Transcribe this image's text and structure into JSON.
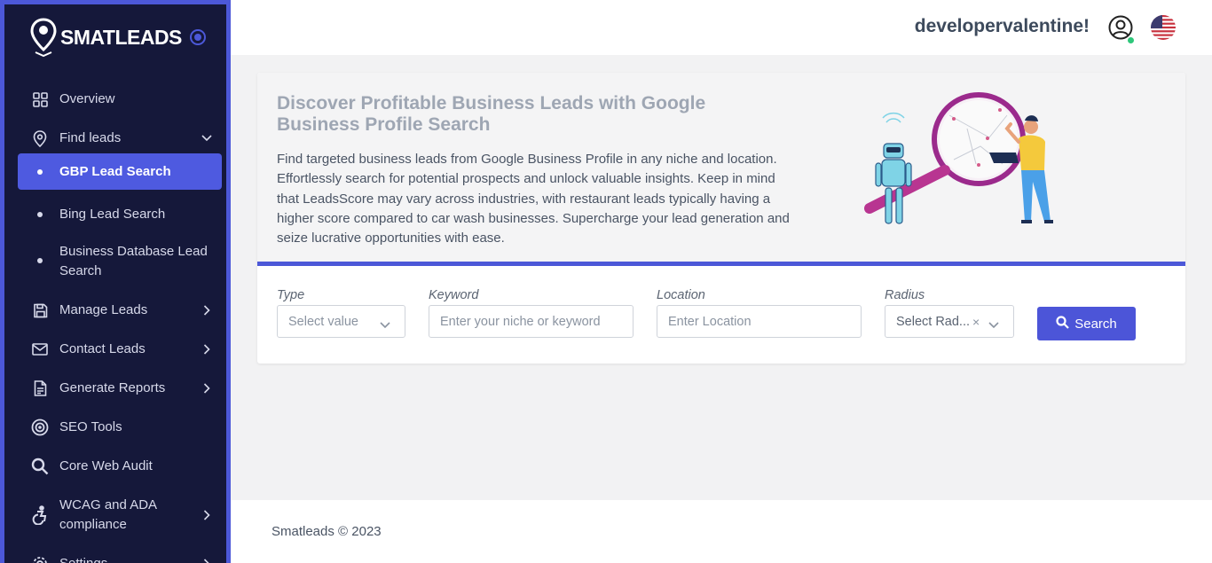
{
  "brand": {
    "name": "SMATLEADS"
  },
  "sidebar": {
    "items": [
      {
        "label": "Overview",
        "icon": "grid-icon"
      },
      {
        "label": "Find leads",
        "icon": "map-pin-icon"
      },
      {
        "label": "Manage Leads",
        "icon": "save-icon"
      },
      {
        "label": "Contact Leads",
        "icon": "mail-icon"
      },
      {
        "label": "Generate Reports",
        "icon": "document-icon"
      },
      {
        "label": "SEO Tools",
        "icon": "target-icon"
      },
      {
        "label": "Core Web Audit",
        "icon": "search-icon"
      },
      {
        "label": "WCAG and ADA compliance",
        "icon": "accessibility-icon"
      },
      {
        "label": "Settings",
        "icon": "settings-icon"
      }
    ],
    "sub_items": [
      {
        "label": "GBP Lead Search",
        "active": true
      },
      {
        "label": "Bing Lead Search",
        "active": false
      },
      {
        "label": "Business Database Lead Search",
        "active": false
      }
    ]
  },
  "header": {
    "username": "developervalentine!"
  },
  "hero": {
    "title": "Discover Profitable Business Leads with Google Business Profile Search",
    "description": "Find targeted business leads from Google Business Profile in any niche and location. Effortlessly search for potential prospects and unlock valuable insights. Keep in mind that LeadsScore may vary across industries, with restaurant leads typically having a higher score compared to car wash businesses. Supercharge your lead generation and seize lucrative opportunities with ease."
  },
  "form": {
    "type": {
      "label": "Type",
      "placeholder": "Select value"
    },
    "keyword": {
      "label": "Keyword",
      "placeholder": "Enter your niche or keyword"
    },
    "location": {
      "label": "Location",
      "placeholder": "Enter Location"
    },
    "radius": {
      "label": "Radius",
      "placeholder": "Select Rad..."
    },
    "search_label": "Search"
  },
  "footer": {
    "text": "Smatleads © 2023"
  },
  "colors": {
    "sidebar_bg": "#15183a",
    "accent": "#4c58d8",
    "online": "#2ec77a"
  }
}
